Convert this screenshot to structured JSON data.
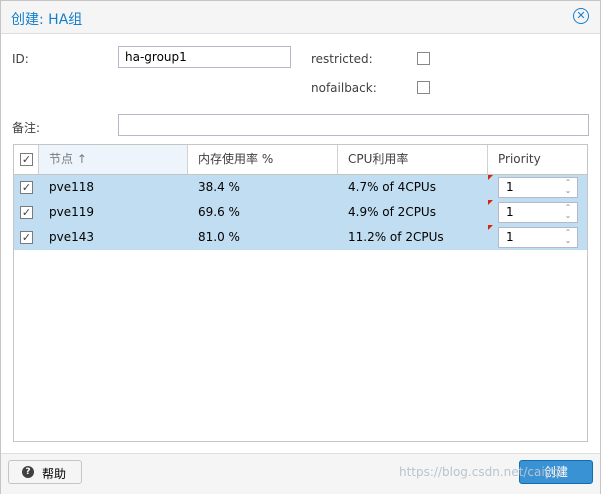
{
  "dialog": {
    "title": "创建: HA组",
    "close_icon": "circle-x-icon"
  },
  "form": {
    "id_label": "ID:",
    "id_value": "ha-group1",
    "restricted_label": "restricted:",
    "restricted_checked": false,
    "nofailback_label": "nofailback:",
    "nofailback_checked": false,
    "comment_label": "备注:",
    "comment_value": ""
  },
  "grid": {
    "columns": [
      "节点 ↑",
      "内存使用率 %",
      "CPU利用率",
      "Priority"
    ],
    "rows": [
      {
        "checked": true,
        "node": "pve118",
        "mem": "38.4 %",
        "cpu": "4.7% of 4CPUs",
        "priority": "1"
      },
      {
        "checked": true,
        "node": "pve119",
        "mem": "69.6 %",
        "cpu": "4.9% of 2CPUs",
        "priority": "1"
      },
      {
        "checked": true,
        "node": "pve143",
        "mem": "81.0 %",
        "cpu": "11.2% of 2CPUs",
        "priority": "1"
      }
    ]
  },
  "footer": {
    "help_label": "帮助",
    "help_icon": "question-circle-icon",
    "create_label": "创建",
    "watermark": "https://blog.csdn.net/caiyqn"
  },
  "colors": {
    "accent": "#157fcc",
    "row_selected": "#c1ddf1",
    "primary_button": "#3892d4",
    "dirty_marker": "#d9240d"
  }
}
